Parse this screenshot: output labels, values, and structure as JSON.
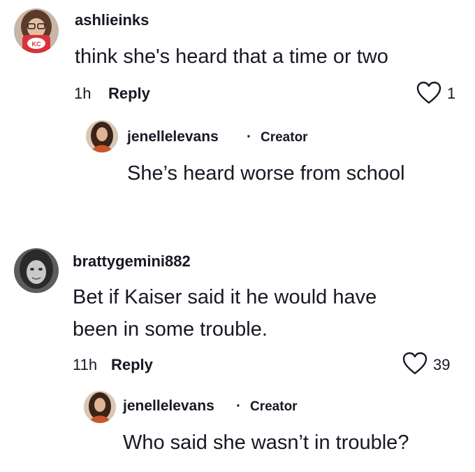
{
  "comments": [
    {
      "username": "ashlieinks",
      "text": "think she's heard that a time or two",
      "time": "1h",
      "reply_label": "Reply",
      "likes": "1",
      "reply": {
        "username": "jenellelevans",
        "separator": "·",
        "badge": "Creator",
        "text": "She’s heard worse from school"
      }
    },
    {
      "username": "brattygemini882",
      "text_line1": "Bet if Kaiser said it he would have",
      "text_line2": "been in some trouble.",
      "time": "11h",
      "reply_label": "Reply",
      "likes": "39",
      "reply": {
        "username": "jenellelevans",
        "separator": "·",
        "badge": "Creator",
        "text": "Who said she wasn’t in trouble?"
      }
    }
  ],
  "colors": {
    "text": "#161823",
    "heart_stroke": "#161823",
    "background": "#ffffff"
  },
  "icons": {
    "like": "heart-outline-icon"
  }
}
